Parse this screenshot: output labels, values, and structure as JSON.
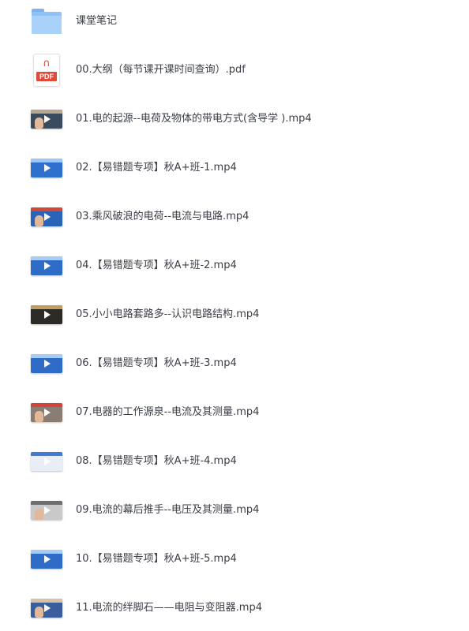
{
  "files": [
    {
      "name": "课堂笔记",
      "type": "folder",
      "icon": "folder-icon"
    },
    {
      "name": "00.大纲（每节课开课时间查询）.pdf",
      "type": "pdf",
      "icon": "pdf-icon",
      "icon_text": "PDF"
    },
    {
      "name": "01.电的起源--电荷及物体的带电方式(含导学 ).mp4",
      "type": "video",
      "icon": "video-thumbnail-icon",
      "thumb": {
        "bg": "#3b4b5e",
        "accent": "#b8a68d",
        "face": true
      }
    },
    {
      "name": "02.【易错题专项】秋A+班-1.mp4",
      "type": "video",
      "icon": "video-thumbnail-icon",
      "thumb": {
        "bg": "#2f6fce",
        "accent": "#9fc6f2",
        "face": false
      }
    },
    {
      "name": "03.乘风破浪的电荷--电流与电路.mp4",
      "type": "video",
      "icon": "video-thumbnail-icon",
      "thumb": {
        "bg": "#2a63b8",
        "accent": "#d04a3a",
        "face": true
      }
    },
    {
      "name": "04.【易错题专项】秋A+班-2.mp4",
      "type": "video",
      "icon": "video-thumbnail-icon",
      "thumb": {
        "bg": "#2e6cc8",
        "accent": "#a8cdf4",
        "face": false
      }
    },
    {
      "name": "05.小小电路套路多--认识电路结构.mp4",
      "type": "video",
      "icon": "video-thumbnail-icon",
      "thumb": {
        "bg": "#2c2a26",
        "accent": "#c0a060",
        "face": false
      }
    },
    {
      "name": "06.【易错题专项】秋A+班-3.mp4",
      "type": "video",
      "icon": "video-thumbnail-icon",
      "thumb": {
        "bg": "#2e6cc8",
        "accent": "#a8cdf4",
        "face": false
      }
    },
    {
      "name": "07.电器的工作源泉--电流及其测量.mp4",
      "type": "video",
      "icon": "video-thumbnail-icon",
      "thumb": {
        "bg": "#8a7d74",
        "accent": "#d2443a",
        "face": true
      }
    },
    {
      "name": "08.【易错题专项】秋A+班-4.mp4",
      "type": "video",
      "icon": "video-thumbnail-icon",
      "thumb": {
        "bg": "#e9eef6",
        "accent": "#3f7bd6",
        "face": false
      }
    },
    {
      "name": "09.电流的幕后推手--电压及其测量.mp4",
      "type": "video",
      "icon": "video-thumbnail-icon",
      "thumb": {
        "bg": "#c9c9c9",
        "accent": "#6e6e6e",
        "face": true
      }
    },
    {
      "name": "10.【易错题专项】秋A+班-5.mp4",
      "type": "video",
      "icon": "video-thumbnail-icon",
      "thumb": {
        "bg": "#2e6cc8",
        "accent": "#a8cdf4",
        "face": false
      }
    },
    {
      "name": "11.电流的绊脚石——电阻与变阻器.mp4",
      "type": "video",
      "icon": "video-thumbnail-icon",
      "thumb": {
        "bg": "#3a5d9e",
        "accent": "#d8c2a4",
        "face": true
      }
    }
  ]
}
